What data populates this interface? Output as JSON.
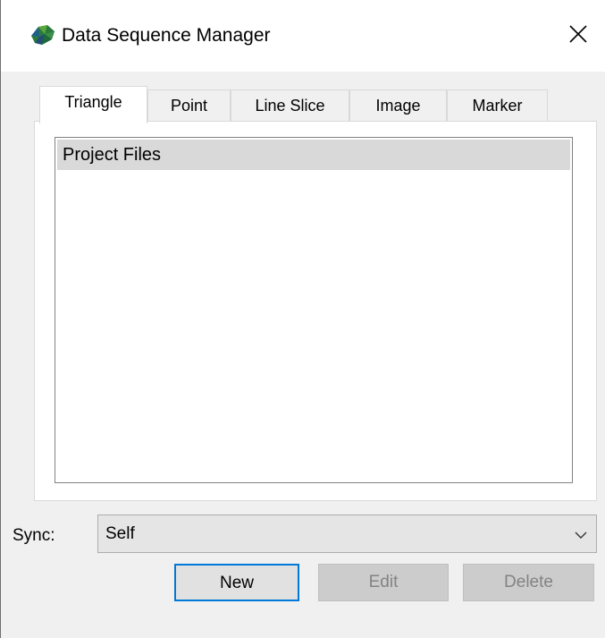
{
  "window": {
    "title": "Data Sequence Manager",
    "app_icon": "colored-mesh-icon",
    "close_icon": "close-icon"
  },
  "tabs": [
    {
      "label": "Triangle",
      "active": true
    },
    {
      "label": "Point",
      "active": false
    },
    {
      "label": "Line Slice",
      "active": false
    },
    {
      "label": "Image",
      "active": false
    },
    {
      "label": "Marker",
      "active": false
    }
  ],
  "list": {
    "items": [
      "Project Files"
    ]
  },
  "sync": {
    "label": "Sync:",
    "value": "Self"
  },
  "buttons": {
    "new": "New",
    "edit": "Edit",
    "delete": "Delete"
  },
  "colors": {
    "accent": "#0078d7",
    "disabled_text": "#838383",
    "selection": "#d9d9d9"
  }
}
